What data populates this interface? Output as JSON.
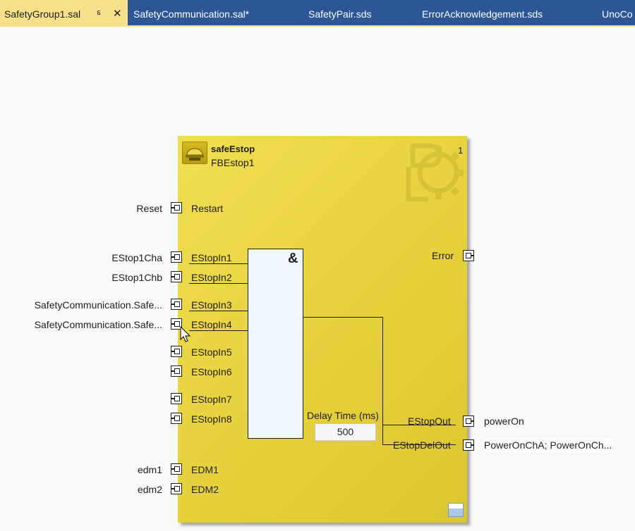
{
  "tabs": [
    {
      "label": "SafetyGroup1.sal",
      "active": true
    },
    {
      "label": "SafetyCommunication.sal*",
      "active": false
    },
    {
      "label": "SafetyPair.sds",
      "active": false
    },
    {
      "label": "ErrorAcknowledgement.sds",
      "active": false
    },
    {
      "label": "UnoCo",
      "active": false
    }
  ],
  "tab_icons": {
    "pin": "pin-icon",
    "close": "close-icon"
  },
  "block": {
    "type_name": "safeEstop",
    "instance_name": "FBEstop1",
    "exec_number": "1",
    "icon": "estop-function-icon",
    "watermark_icon": "safety-gear-watermark-icon",
    "and_symbol": "&",
    "delay_label": "Delay Time (ms)",
    "delay_value": "500",
    "inputs": [
      {
        "pin": "Restart",
        "connection": "Reset"
      },
      {
        "pin": "EStopIn1",
        "connection": "EStop1Cha"
      },
      {
        "pin": "EStopIn2",
        "connection": "EStop1Chb"
      },
      {
        "pin": "EStopIn3",
        "connection": "SafetyCommunication.Safe..."
      },
      {
        "pin": "EStopIn4",
        "connection": "SafetyCommunication.Safe..."
      },
      {
        "pin": "EStopIn5",
        "connection": ""
      },
      {
        "pin": "EStopIn6",
        "connection": ""
      },
      {
        "pin": "EStopIn7",
        "connection": ""
      },
      {
        "pin": "EStopIn8",
        "connection": ""
      },
      {
        "pin": "EDM1",
        "connection": "edm1"
      },
      {
        "pin": "EDM2",
        "connection": "edm2"
      }
    ],
    "outputs": [
      {
        "pin": "Error",
        "connection": ""
      },
      {
        "pin": "EStopOut",
        "connection": "powerOn"
      },
      {
        "pin": "EStopDelOut",
        "connection": "PowerOnChA; PowerOnCh..."
      }
    ]
  },
  "colors": {
    "tabbar": "#2d5696",
    "active_tab": "#f6e18a",
    "block_fill": "#e8d440",
    "and_box_fill": "#f1f7ff"
  }
}
